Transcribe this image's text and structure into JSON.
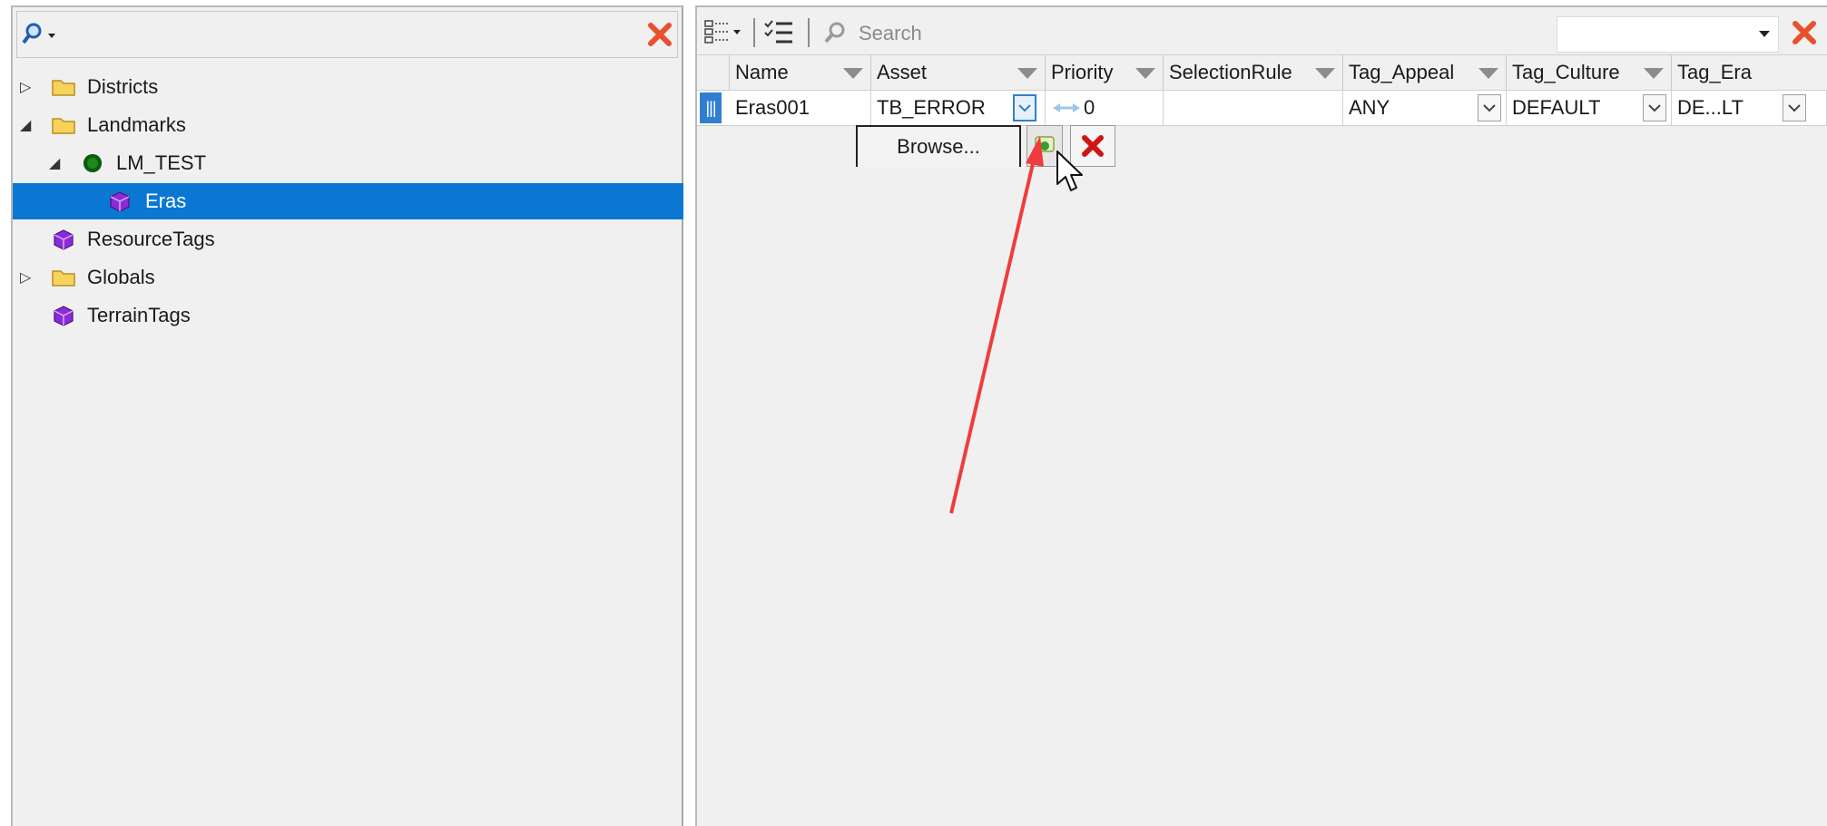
{
  "left_panel": {
    "toolbar": {
      "search_icon": "search-icon",
      "close_icon": "close-icon"
    },
    "tree": [
      {
        "label": "Districts",
        "type": "folder",
        "expander": "collapsed"
      },
      {
        "label": "Landmarks",
        "type": "folder",
        "expander": "expanded"
      },
      {
        "label": "LM_TEST",
        "type": "node",
        "expander": "expanded"
      },
      {
        "label": "Eras",
        "type": "cube",
        "selected": true
      },
      {
        "label": "ResourceTags",
        "type": "cube"
      },
      {
        "label": "Globals",
        "type": "folder",
        "expander": "collapsed"
      },
      {
        "label": "TerrainTags",
        "type": "cube"
      }
    ]
  },
  "right_panel": {
    "toolbar": {
      "columns_icon": "columns-icon",
      "checklist_icon": "checklist-icon",
      "search_placeholder": "Search",
      "close_icon": "close-icon"
    },
    "columns": [
      "Name",
      "Asset",
      "Priority",
      "SelectionRule",
      "Tag_Appeal",
      "Tag_Culture",
      "Tag_Era"
    ],
    "row": {
      "name": "Eras001",
      "asset": "TB_ERROR",
      "priority": "0",
      "selection_rule": "",
      "tag_appeal": "ANY",
      "tag_culture": "DEFAULT",
      "tag_era": "DE...LT"
    },
    "editor": {
      "browse_label": "Browse..."
    }
  },
  "colors": {
    "selection": "#0a78d2",
    "annotation_arrow": "#f03c3c",
    "close_x": "#e8502e"
  }
}
